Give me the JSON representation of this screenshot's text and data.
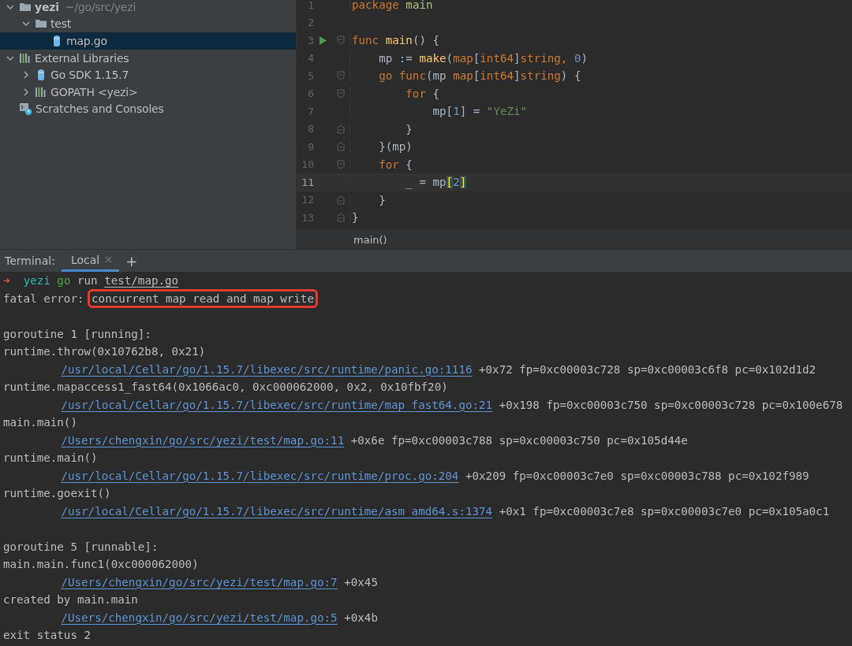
{
  "project_tree": {
    "items": [
      {
        "label": "yezi",
        "path": "~/go/src/yezi",
        "kind": "folder",
        "expanded": true,
        "selected": false,
        "children": [
          {
            "label": "test",
            "kind": "folder",
            "expanded": true,
            "selected": false,
            "children": [
              {
                "label": "map.go",
                "kind": "gofile",
                "selected": true
              }
            ]
          }
        ]
      },
      {
        "label": "External Libraries",
        "kind": "library",
        "expanded": true,
        "selected": false,
        "children": [
          {
            "label": "Go SDK 1.15.7",
            "kind": "sdk",
            "expanded": false,
            "selected": false
          },
          {
            "label": "GOPATH <yezi>",
            "kind": "library",
            "expanded": false,
            "selected": false
          }
        ]
      },
      {
        "label": "Scratches and Consoles",
        "kind": "scratches",
        "selected": false
      }
    ]
  },
  "editor": {
    "lines": [
      {
        "number": "1",
        "kind": "plain",
        "current": false,
        "tokens": [
          {
            "kind": "keyword",
            "text": "package"
          },
          {
            "kind": "package",
            "text": " main"
          }
        ]
      },
      {
        "number": "2",
        "kind": "plain",
        "current": false
      },
      {
        "number": "3",
        "kind": "run-fold-start",
        "current": false,
        "tokens": [
          {
            "kind": "keyword",
            "text": "func"
          },
          {
            "kind": "func",
            "text": " main"
          },
          {
            "kind": "plain",
            "text": "() {"
          }
        ]
      },
      {
        "number": "4",
        "kind": "plain",
        "current": false,
        "tokens": [
          {
            "kind": "plain",
            "text": "    mp := "
          },
          {
            "kind": "func",
            "text": "make"
          },
          {
            "kind": "plain",
            "text": "("
          },
          {
            "kind": "type",
            "text": "map"
          },
          {
            "kind": "plain",
            "text": "["
          },
          {
            "kind": "type",
            "text": "int64"
          },
          {
            "kind": "plain",
            "text": "]"
          },
          {
            "kind": "type",
            "text": "string"
          },
          {
            "kind": "keyword",
            "text": ", "
          },
          {
            "kind": "number",
            "text": "0"
          },
          {
            "kind": "plain",
            "text": ")"
          }
        ]
      },
      {
        "number": "5",
        "kind": "fold-start",
        "current": false,
        "tokens": [
          {
            "kind": "keyword",
            "text": "    go"
          },
          {
            "kind": "keyword",
            "text": " func"
          },
          {
            "kind": "plain",
            "text": "(mp "
          },
          {
            "kind": "type",
            "text": "map"
          },
          {
            "kind": "plain",
            "text": "["
          },
          {
            "kind": "type",
            "text": "int64"
          },
          {
            "kind": "plain",
            "text": "]"
          },
          {
            "kind": "type",
            "text": "string"
          },
          {
            "kind": "plain",
            "text": ") {"
          }
        ]
      },
      {
        "number": "6",
        "kind": "fold-start",
        "current": false,
        "tokens": [
          {
            "kind": "keyword",
            "text": "        for"
          },
          {
            "kind": "plain",
            "text": " {"
          }
        ]
      },
      {
        "number": "7",
        "kind": "plain",
        "current": false,
        "tokens": [
          {
            "kind": "plain",
            "text": "            mp["
          },
          {
            "kind": "number",
            "text": "1"
          },
          {
            "kind": "plain",
            "text": "] = "
          },
          {
            "kind": "string",
            "text": "\"YeZi\""
          }
        ]
      },
      {
        "number": "8",
        "kind": "fold-end",
        "current": false,
        "tokens": [
          {
            "kind": "plain",
            "text": "        }"
          }
        ]
      },
      {
        "number": "9",
        "kind": "fold-end",
        "current": false,
        "tokens": [
          {
            "kind": "plain",
            "text": "    }(mp)"
          }
        ]
      },
      {
        "number": "10",
        "kind": "fold-start",
        "current": false,
        "tokens": [
          {
            "kind": "keyword",
            "text": "    for"
          },
          {
            "kind": "plain",
            "text": " {"
          }
        ]
      },
      {
        "number": "11",
        "kind": "plain",
        "current": true,
        "tokens": [
          {
            "kind": "plain",
            "text": "        _ = mp"
          },
          {
            "kind": "match",
            "text": "["
          },
          {
            "kind": "number",
            "text": "2"
          },
          {
            "kind": "match",
            "text": "]"
          }
        ]
      },
      {
        "number": "12",
        "kind": "fold-end",
        "current": false,
        "tokens": [
          {
            "kind": "plain",
            "text": "    }"
          }
        ]
      },
      {
        "number": "13",
        "kind": "fold-end",
        "current": false,
        "tokens": [
          {
            "kind": "plain",
            "text": "}"
          }
        ]
      }
    ],
    "breadcrumb": "main()"
  },
  "terminal": {
    "title": "Terminal:",
    "tabs": [
      {
        "label": "Local",
        "selected": true
      }
    ],
    "new_tab": "+",
    "lines": [
      {
        "kind": "line",
        "segments": [
          {
            "kind": "arrow",
            "text": "➜"
          },
          {
            "kind": "dir",
            "text": "  yezi"
          },
          {
            "kind": "git",
            "text": " go"
          },
          {
            "kind": "plain",
            "text": " run "
          },
          {
            "kind": "path",
            "text": "test/map.go"
          }
        ]
      },
      {
        "kind": "line",
        "segments": [
          {
            "kind": "plain",
            "text": "fatal error: "
          },
          {
            "kind": "boxed",
            "text": "concurrent map read and map write"
          }
        ]
      },
      {
        "kind": "blank"
      },
      {
        "kind": "line",
        "segments": [
          {
            "kind": "plain",
            "text": "goroutine 1 [running]:"
          }
        ]
      },
      {
        "kind": "line",
        "segments": [
          {
            "kind": "plain",
            "text": "runtime.throw(0x10762b8, 0x21)"
          }
        ]
      },
      {
        "kind": "frame",
        "segments": [
          {
            "kind": "link",
            "text": "/usr/local/Cellar/go/1.15.7/libexec/src/runtime/panic.go:1116"
          },
          {
            "kind": "plain",
            "text": " +0x72 fp=0xc00003c728 sp=0xc00003c6f8 pc=0x102d1d2"
          }
        ]
      },
      {
        "kind": "line",
        "segments": [
          {
            "kind": "plain",
            "text": "runtime.mapaccess1_fast64(0x1066ac0, 0xc000062000, 0x2, 0x10fbf20)"
          }
        ]
      },
      {
        "kind": "frame",
        "segments": [
          {
            "kind": "link",
            "text": "/usr/local/Cellar/go/1.15.7/libexec/src/runtime/map_fast64.go:21"
          },
          {
            "kind": "plain",
            "text": " +0x198 fp=0xc00003c750 sp=0xc00003c728 pc=0x100e678"
          }
        ]
      },
      {
        "kind": "line",
        "segments": [
          {
            "kind": "plain",
            "text": "main.main()"
          }
        ]
      },
      {
        "kind": "frame",
        "segments": [
          {
            "kind": "link",
            "text": "/Users/chengxin/go/src/yezi/test/map.go:11"
          },
          {
            "kind": "plain",
            "text": " +0x6e fp=0xc00003c788 sp=0xc00003c750 pc=0x105d44e"
          }
        ]
      },
      {
        "kind": "line",
        "segments": [
          {
            "kind": "plain",
            "text": "runtime.main()"
          }
        ]
      },
      {
        "kind": "frame",
        "segments": [
          {
            "kind": "link",
            "text": "/usr/local/Cellar/go/1.15.7/libexec/src/runtime/proc.go:204"
          },
          {
            "kind": "plain",
            "text": " +0x209 fp=0xc00003c7e0 sp=0xc00003c788 pc=0x102f989"
          }
        ]
      },
      {
        "kind": "line",
        "segments": [
          {
            "kind": "plain",
            "text": "runtime.goexit()"
          }
        ]
      },
      {
        "kind": "frame",
        "segments": [
          {
            "kind": "link",
            "text": "/usr/local/Cellar/go/1.15.7/libexec/src/runtime/asm_amd64.s:1374"
          },
          {
            "kind": "plain",
            "text": " +0x1 fp=0xc00003c7e8 sp=0xc00003c7e0 pc=0x105a0c1"
          }
        ]
      },
      {
        "kind": "blank"
      },
      {
        "kind": "line",
        "segments": [
          {
            "kind": "plain",
            "text": "goroutine 5 [runnable]:"
          }
        ]
      },
      {
        "kind": "line",
        "segments": [
          {
            "kind": "plain",
            "text": "main.main.func1(0xc000062000)"
          }
        ]
      },
      {
        "kind": "frame",
        "segments": [
          {
            "kind": "link",
            "text": "/Users/chengxin/go/src/yezi/test/map.go:7"
          },
          {
            "kind": "plain",
            "text": " +0x45"
          }
        ]
      },
      {
        "kind": "line",
        "segments": [
          {
            "kind": "plain",
            "text": "created by main.main"
          }
        ]
      },
      {
        "kind": "frame",
        "segments": [
          {
            "kind": "link",
            "text": "/Users/chengxin/go/src/yezi/test/map.go:5"
          },
          {
            "kind": "plain",
            "text": " +0x4b"
          }
        ]
      },
      {
        "kind": "line",
        "segments": [
          {
            "kind": "plain",
            "text": "exit status 2"
          }
        ]
      }
    ]
  }
}
